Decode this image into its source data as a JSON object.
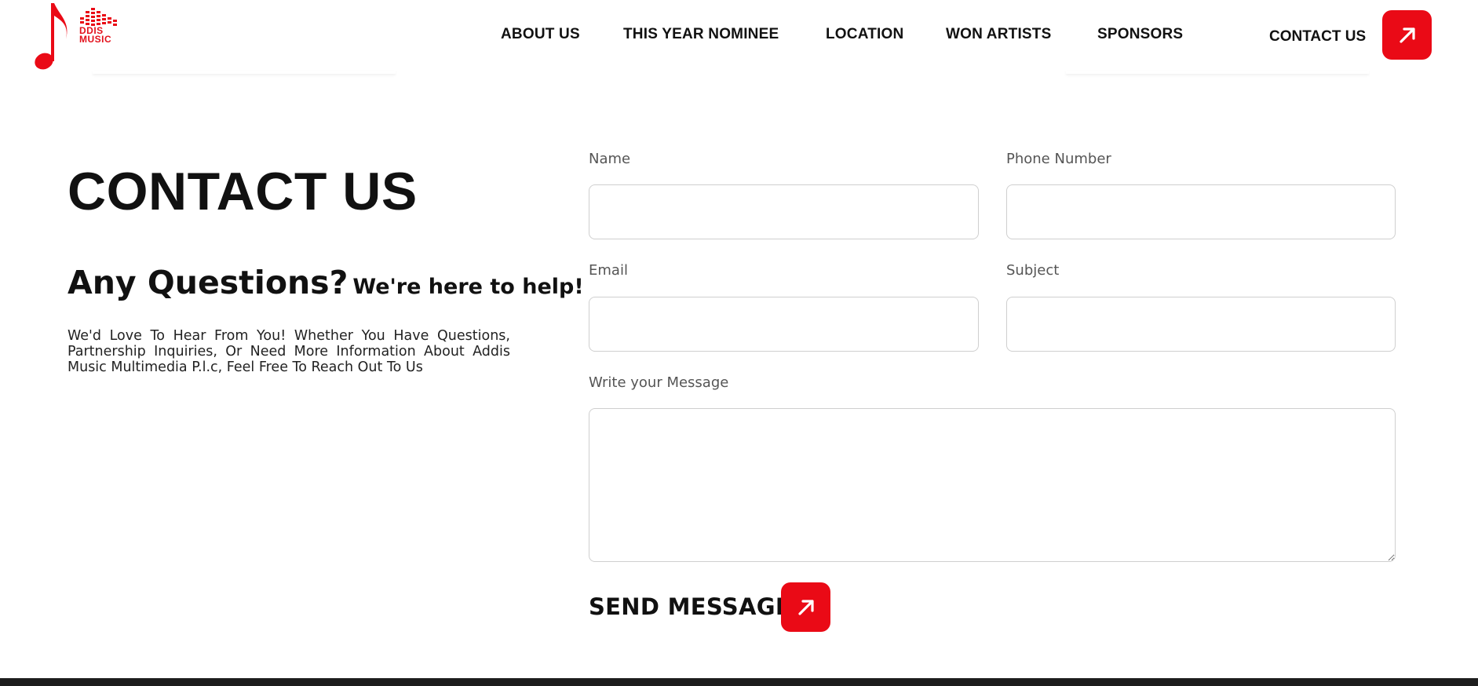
{
  "logo": {
    "text_line1": "DDIS",
    "text_line2": "MUSIC",
    "brand_color": "#ea0a16"
  },
  "nav": {
    "items": [
      "ABOUT US",
      "THIS YEAR NOMINEE",
      "LOCATION",
      "WON ARTISTS",
      "SPONSORS"
    ],
    "contact_label": "CONTACT US",
    "contact_icon": "arrow-up-right-icon"
  },
  "page": {
    "title": "CONTACT US",
    "question": "Any Questions?",
    "question_sub": "We're here to help!",
    "intro": "We'd Love To Hear From You! Whether You Have Questions, Partnership Inquiries, Or Need More Information About Addis Music Multimedia P.l.c, Feel Free To Reach Out To Us"
  },
  "form": {
    "name_label": "Name",
    "name_value": "",
    "phone_label": "Phone Number",
    "phone_value": "",
    "email_label": "Email",
    "email_value": "",
    "subject_label": "Subject",
    "subject_value": "",
    "message_label": "Write your Message",
    "message_value": "",
    "send_label": "SEND MESSAGE",
    "send_icon": "arrow-up-right-icon"
  },
  "colors": {
    "accent": "#ea0a16",
    "text": "#111111",
    "label": "#555555",
    "border": "#cfcfcf",
    "footer": "#1d1d1d"
  }
}
